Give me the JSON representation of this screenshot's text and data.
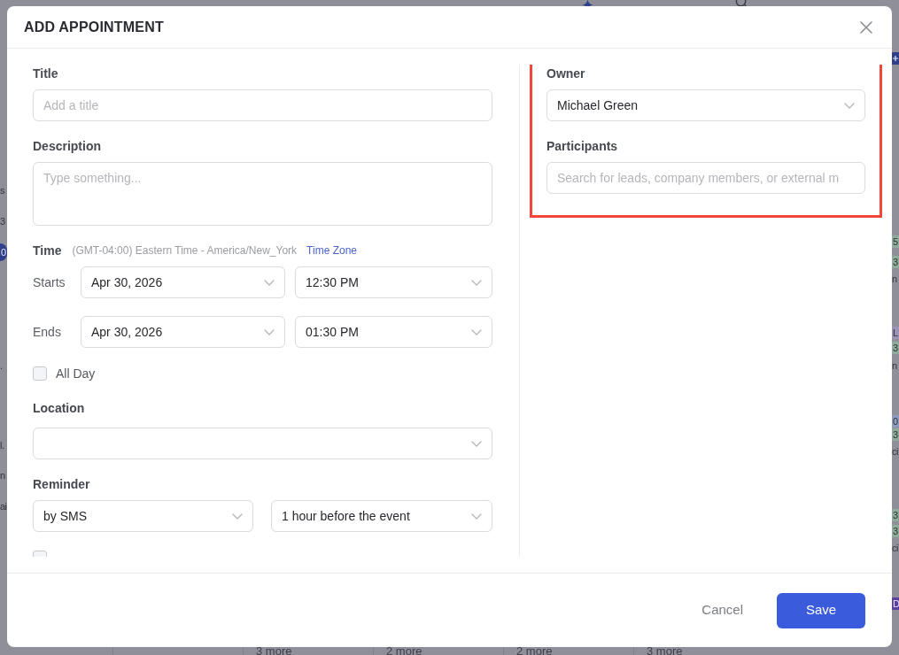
{
  "background": {
    "left_edge": [
      {
        "kind": "text",
        "text": "s"
      },
      {
        "kind": "text",
        "text": "3"
      },
      {
        "kind": "badge",
        "text": "0"
      },
      {
        "kind": "text",
        "text": "."
      },
      {
        "kind": "text",
        "text": "l."
      },
      {
        "kind": "text",
        "text": "n"
      },
      {
        "kind": "text",
        "text": "ai"
      }
    ],
    "right_edge": [
      {
        "kind": "tag",
        "text": "5",
        "color": "#8fab9c"
      },
      {
        "kind": "tag",
        "text": "3",
        "color": "#8fab9c"
      },
      {
        "kind": "text",
        "text": "n"
      },
      {
        "kind": "tag",
        "text": "L",
        "color": "#9d93b9"
      },
      {
        "kind": "tag",
        "text": "3",
        "color": "#8fab9c"
      },
      {
        "kind": "text",
        "text": "n"
      },
      {
        "kind": "tag",
        "text": "0",
        "color": "#8e9ac0"
      },
      {
        "kind": "tag",
        "text": "3",
        "color": "#8fab9c"
      },
      {
        "kind": "text",
        "text": "ci"
      },
      {
        "kind": "tag",
        "text": "3",
        "color": "#8fab9c"
      },
      {
        "kind": "tag",
        "text": "3",
        "color": "#8fab9c"
      },
      {
        "kind": "text",
        "text": "ci"
      },
      {
        "kind": "tag",
        "text": "D",
        "color": "#5c3f9f"
      }
    ],
    "more_links": [
      "3 more",
      "2 more",
      "2 more",
      "3 more"
    ]
  },
  "dialog": {
    "title": "ADD APPOINTMENT",
    "title_field": {
      "label": "Title",
      "placeholder": "Add a title"
    },
    "description_field": {
      "label": "Description",
      "placeholder": "Type something..."
    },
    "time": {
      "label": "Time",
      "timezone": "(GMT-04:00) Eastern Time - America/New_York",
      "timezone_link": "Time Zone",
      "rows": [
        {
          "label": "Starts",
          "date": "Apr 30, 2026",
          "time": "12:30 PM"
        },
        {
          "label": "Ends",
          "date": "Apr 30, 2026",
          "time": "01:30 PM"
        }
      ]
    },
    "all_day": {
      "label": "All Day",
      "checked": false
    },
    "location": {
      "label": "Location"
    },
    "reminder": {
      "label": "Reminder",
      "method": "by SMS",
      "timing": "1 hour before the event"
    },
    "send_reminder": {
      "checked": false
    },
    "owner_section": {
      "highlighted": true,
      "owner": {
        "label": "Owner",
        "value": "Michael Green"
      },
      "participants": {
        "label": "Participants",
        "placeholder": "Search for leads, company members, or external m"
      }
    },
    "buttons": [
      {
        "label": "Cancel",
        "kind": "secondary"
      },
      {
        "label": "Save",
        "kind": "primary"
      }
    ]
  }
}
